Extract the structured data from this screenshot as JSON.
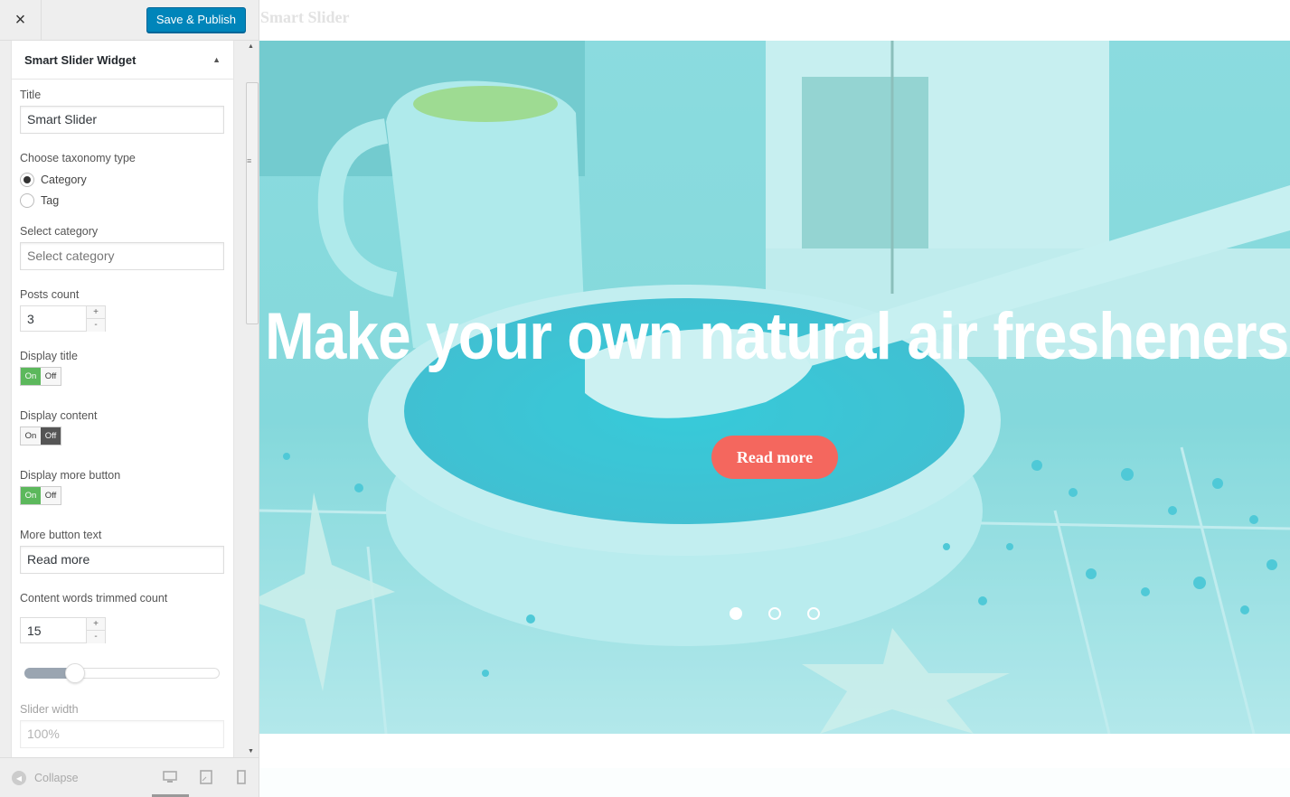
{
  "topbar": {
    "close_icon": "×",
    "publish_label": "Save & Publish"
  },
  "widget": {
    "title": "Smart Slider Widget",
    "fields": {
      "title_label": "Title",
      "title_value": "Smart Slider",
      "taxonomy_label": "Choose taxonomy type",
      "taxonomy_options": [
        "Category",
        "Tag"
      ],
      "taxonomy_selected": "Category",
      "category_label": "Select category",
      "category_placeholder": "Select category",
      "posts_count_label": "Posts count",
      "posts_count_value": "3",
      "display_title_label": "Display title",
      "display_content_label": "Display content",
      "display_more_label": "Display more button",
      "toggle_on": "On",
      "toggle_off": "Off",
      "display_title": true,
      "display_content": false,
      "display_more": true,
      "more_text_label": "More button text",
      "more_text_value": "Read more",
      "trimmed_label": "Content words trimmed count",
      "trimmed_value": "15",
      "trimmed_slider_fraction": 0.26,
      "slider_width_label": "Slider width",
      "slider_width_value": "100%",
      "stepper_up": "+",
      "stepper_down": "-"
    }
  },
  "footer": {
    "collapse_label": "Collapse",
    "devices": [
      "desktop",
      "tablet",
      "mobile"
    ]
  },
  "preview": {
    "site_title": "Smart Slider",
    "slide_heading": "Make your own natural air fresheners",
    "slide_button": "Read more",
    "dots_count": 3,
    "active_dot": 0
  },
  "colors": {
    "accent": "#0085ba",
    "slide_tint": "#7fd8dc",
    "button": "#f4675e",
    "toggle_on": "#5cb85c"
  }
}
